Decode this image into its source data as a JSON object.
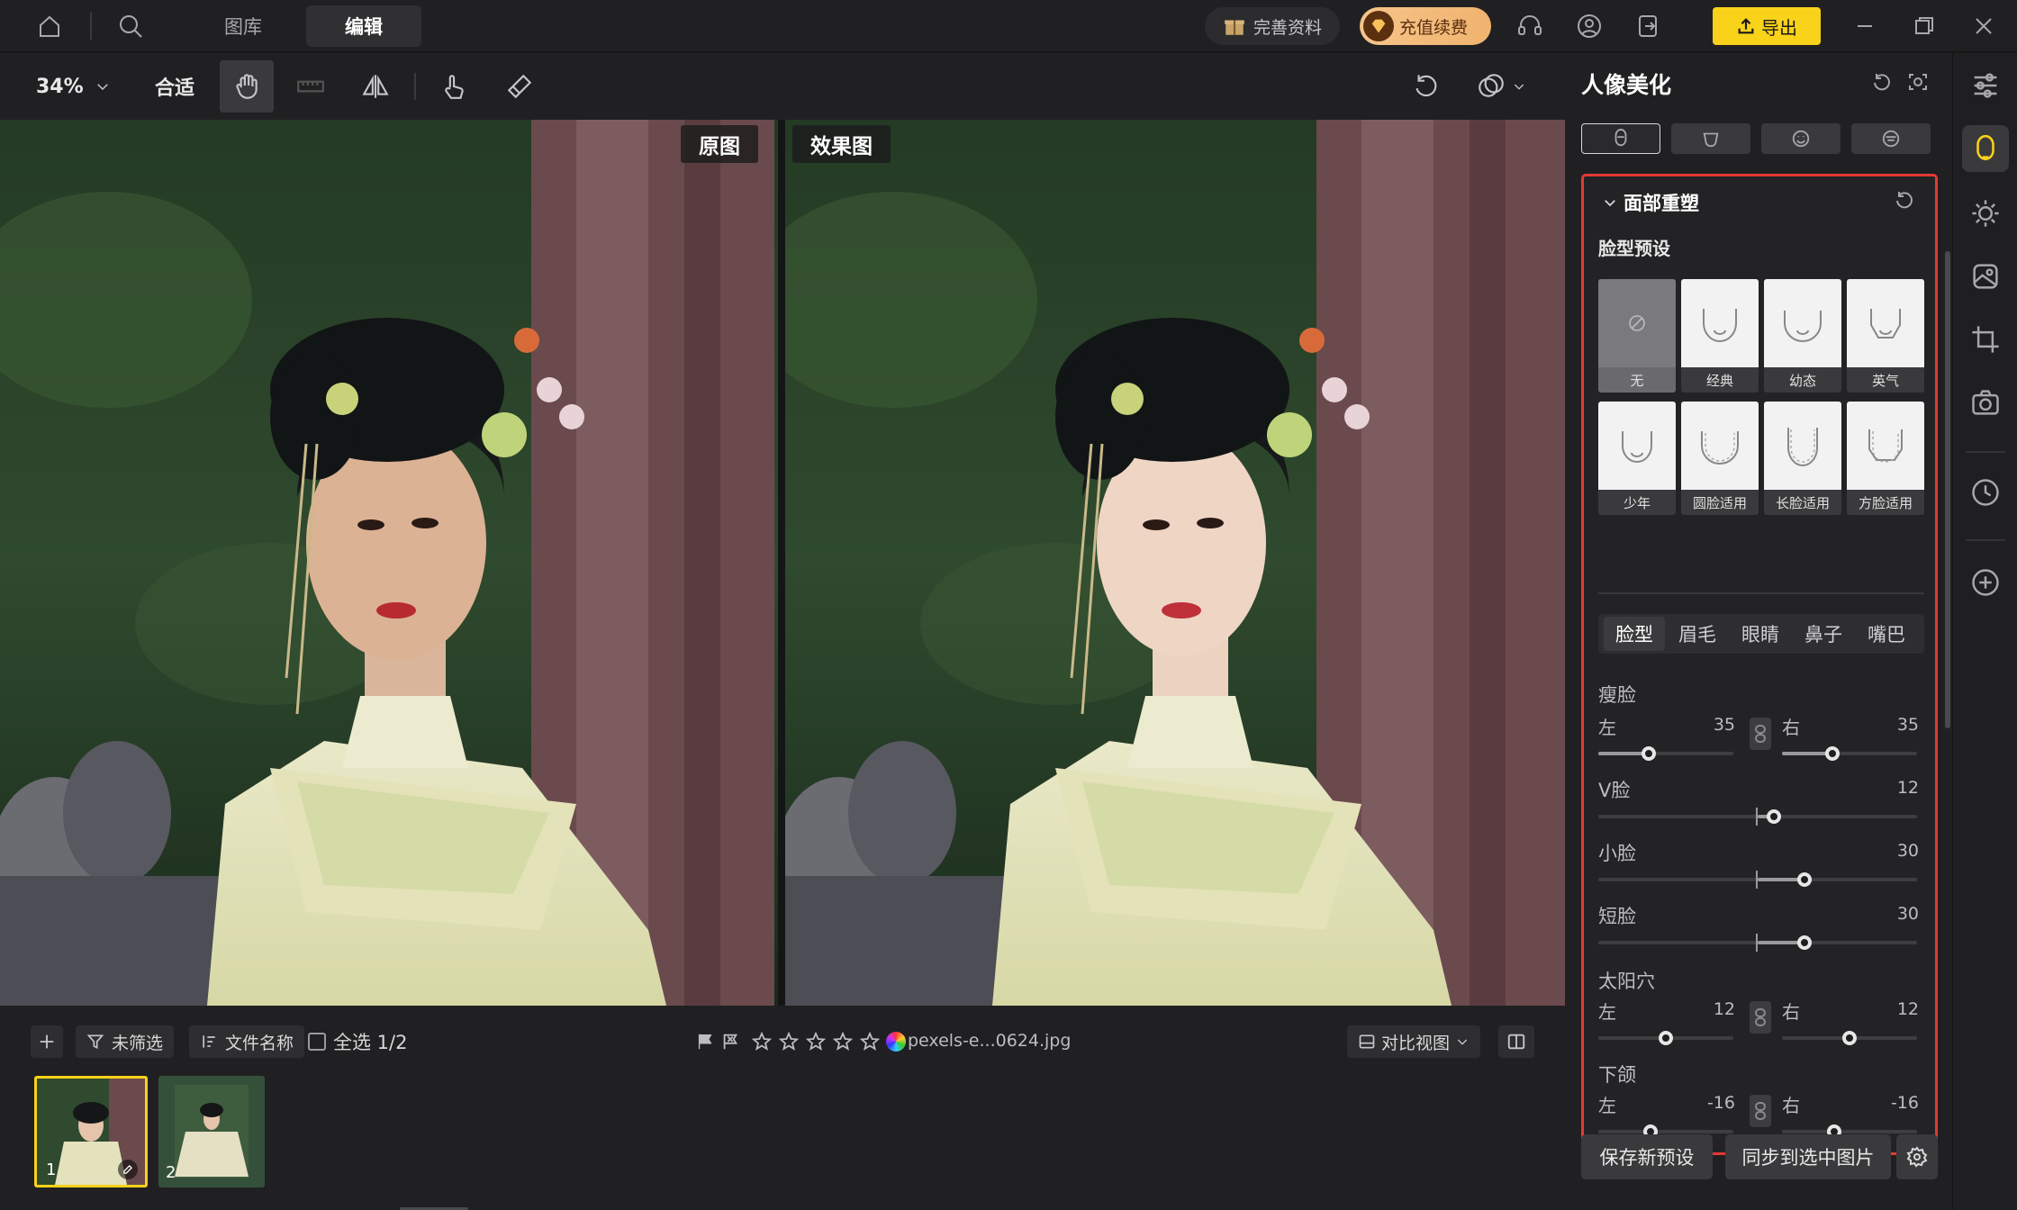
{
  "nav": {
    "gallery": "图库",
    "edit": "编辑",
    "profile_promo": "完善资料",
    "recharge": "充值续费",
    "export": "导出"
  },
  "toolbar": {
    "zoom": "34%",
    "fit": "合适"
  },
  "compare": {
    "original_tag": "原图",
    "result_tag": "效果图"
  },
  "filmbar": {
    "filter": "未筛选",
    "sort": "文件名称",
    "select_all": "全选 1/2",
    "filename": "pexels-e...0624.jpg",
    "compare_view": "对比视图",
    "thumbs": [
      {
        "num": "1"
      },
      {
        "num": "2"
      }
    ]
  },
  "panel": {
    "title": "人像美化",
    "section": "面部重塑",
    "presets_title": "脸型预设",
    "presets": [
      "无",
      "经典",
      "幼态",
      "英气",
      "少年",
      "圆脸适用",
      "长脸适用",
      "方脸适用"
    ],
    "tabs": [
      "脸型",
      "眉毛",
      "眼睛",
      "鼻子",
      "嘴巴"
    ],
    "sliders": {
      "thin_face": {
        "label": "瘦脸",
        "left_label": "左",
        "left_value": "35",
        "right_label": "右",
        "right_value": "35"
      },
      "v_face": {
        "label": "V脸",
        "value": "12"
      },
      "small_face": {
        "label": "小脸",
        "value": "30"
      },
      "short_face": {
        "label": "短脸",
        "value": "30"
      },
      "temple": {
        "label": "太阳穴",
        "left_label": "左",
        "left_value": "12",
        "right_label": "右",
        "right_value": "12"
      },
      "jaw": {
        "label": "下颌",
        "left_label": "左",
        "left_value": "-16",
        "right_label": "右",
        "right_value": "-16"
      }
    },
    "save_preset": "保存新预设",
    "sync": "同步到选中图片"
  },
  "colors": {
    "accent": "#f9d21a",
    "highlight_border": "#e53935",
    "panel_bg": "#202022"
  }
}
